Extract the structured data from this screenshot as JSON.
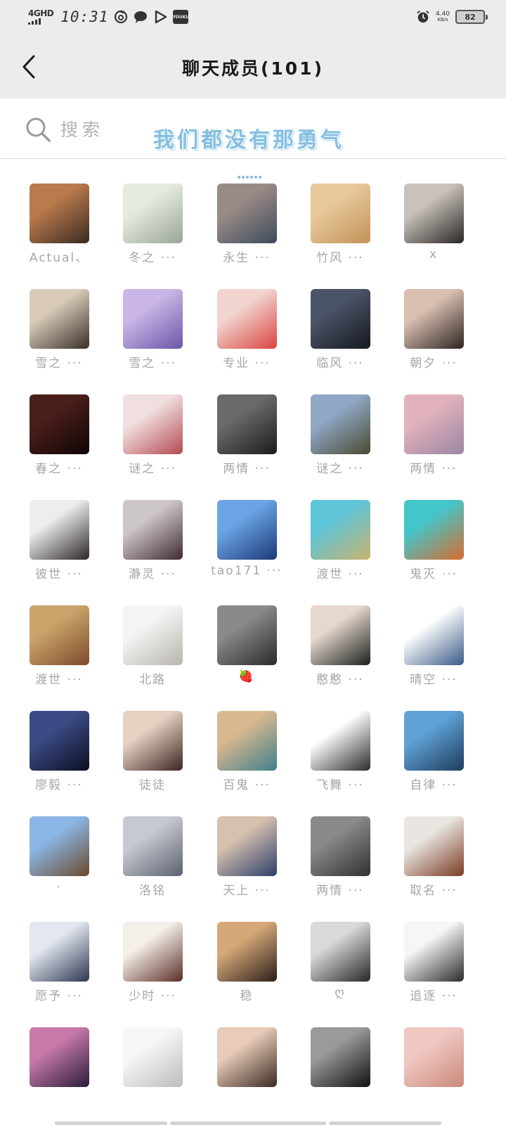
{
  "status_bar": {
    "network": "4GHD",
    "time": "10:31",
    "speed_value": "4.40",
    "speed_unit": "KB/s",
    "battery": "82",
    "app_icons": [
      "netease-music-icon",
      "message-bubble-icon",
      "video-play-icon",
      "youku-icon"
    ],
    "youku_label": "YOUKU"
  },
  "header": {
    "title": "聊天成员(101)",
    "back_icon": "chevron-left-icon"
  },
  "search": {
    "placeholder": "搜索",
    "decor_text": "我们都没有那勇气"
  },
  "colors": {
    "header_bg": "#ececec",
    "name_text": "#a6a6a6",
    "decor_text": "#86bfe0"
  },
  "members": [
    {
      "name": "Actual、",
      "c1": "#b97a4c",
      "c2": "#3b2a22"
    },
    {
      "name": "冬之 ···",
      "c1": "#e4eadf",
      "c2": "#9aa597"
    },
    {
      "name": "永生 ···",
      "c1": "#9a8a86",
      "c2": "#3d4b5c"
    },
    {
      "name": "竹风 ···",
      "c1": "#e8c79a",
      "c2": "#c2925a"
    },
    {
      "name": "x",
      "c1": "#c9c2bb",
      "c2": "#2b2726"
    },
    {
      "name": "雪之 ···",
      "c1": "#d9cbb8",
      "c2": "#3a302a"
    },
    {
      "name": "雪之 ···",
      "c1": "#c9b6e6",
      "c2": "#6b56a8"
    },
    {
      "name": "专业 ···",
      "c1": "#f2d4cf",
      "c2": "#d9453f"
    },
    {
      "name": "临风 ···",
      "c1": "#4b5366",
      "c2": "#151820"
    },
    {
      "name": "朝夕 ···",
      "c1": "#d8bfb0",
      "c2": "#2e2422"
    },
    {
      "name": "春之 ···",
      "c1": "#4a1e1a",
      "c2": "#0d0606"
    },
    {
      "name": "谜之 ···",
      "c1": "#f1dfe0",
      "c2": "#b34b52"
    },
    {
      "name": "两情 ···",
      "c1": "#6a6a6a",
      "c2": "#1b1b1b"
    },
    {
      "name": "谜之 ···",
      "c1": "#8fa8c6",
      "c2": "#4a4a32"
    },
    {
      "name": "两情 ···",
      "c1": "#e1b2bb",
      "c2": "#9a85a3"
    },
    {
      "name": "彼世 ···",
      "c1": "#ededed",
      "c2": "#2c2626"
    },
    {
      "name": "瀞灵 ···",
      "c1": "#cdc6c8",
      "c2": "#3f2b31"
    },
    {
      "name": "tao171 ···",
      "c1": "#6aa4e5",
      "c2": "#1c3978"
    },
    {
      "name": "渡世 ···",
      "c1": "#5ec4d8",
      "c2": "#c8b46e"
    },
    {
      "name": "鬼灭 ···",
      "c1": "#43c6c9",
      "c2": "#d96a2e"
    },
    {
      "name": "渡世 ···",
      "c1": "#c9a46a",
      "c2": "#7d4b2c"
    },
    {
      "name": "北路",
      "c1": "#f4f4f2",
      "c2": "#b8b5ae"
    },
    {
      "name": "🍓",
      "c1": "#8a8a8a",
      "c2": "#2a2a2a"
    },
    {
      "name": "憨憨 ···",
      "c1": "#e6d8cf",
      "c2": "#1a1f1c"
    },
    {
      "name": "晴空 ···",
      "c1": "#ffffff",
      "c2": "#3a5a86"
    },
    {
      "name": "廖毅 ···",
      "c1": "#3b4b85",
      "c2": "#0c0f22"
    },
    {
      "name": "徒徒",
      "c1": "#e6d0c2",
      "c2": "#3a2620"
    },
    {
      "name": "百鬼 ···",
      "c1": "#d9b890",
      "c2": "#3f7f8a"
    },
    {
      "name": "飞舞 ···",
      "c1": "#ffffff",
      "c2": "#2b2b2b"
    },
    {
      "name": "自律 ···",
      "c1": "#5fa2d6",
      "c2": "#1f3b5c"
    },
    {
      "name": "·",
      "c1": "#8bb7e6",
      "c2": "#6b4a2e"
    },
    {
      "name": "洛铭",
      "c1": "#c6c9cf",
      "c2": "#5d6170"
    },
    {
      "name": "天上 ···",
      "c1": "#d6c0ae",
      "c2": "#2d3e6a"
    },
    {
      "name": "两情 ···",
      "c1": "#8a8a8a",
      "c2": "#303030"
    },
    {
      "name": "取名 ···",
      "c1": "#e9e6e2",
      "c2": "#7a3a22"
    },
    {
      "name": "愿予 ···",
      "c1": "#e3e8f0",
      "c2": "#2d3550"
    },
    {
      "name": "少时 ···",
      "c1": "#f4efe9",
      "c2": "#5c2f26"
    },
    {
      "name": "稳",
      "c1": "#d6a878",
      "c2": "#2a1f1a"
    },
    {
      "name": "ღ",
      "c1": "#d9d9d9",
      "c2": "#262626"
    },
    {
      "name": "追逐 ···",
      "c1": "#f6f6f6",
      "c2": "#2b2b2b"
    },
    {
      "name": "",
      "c1": "#c77aa8",
      "c2": "#2b1c3a"
    },
    {
      "name": "",
      "c1": "#f7f7f7",
      "c2": "#bcbcbc"
    },
    {
      "name": "",
      "c1": "#e8cbb8",
      "c2": "#3a2a22"
    },
    {
      "name": "",
      "c1": "#9a9a9a",
      "c2": "#111111"
    },
    {
      "name": "",
      "c1": "#f1c7c2",
      "c2": "#c98a7a"
    }
  ]
}
